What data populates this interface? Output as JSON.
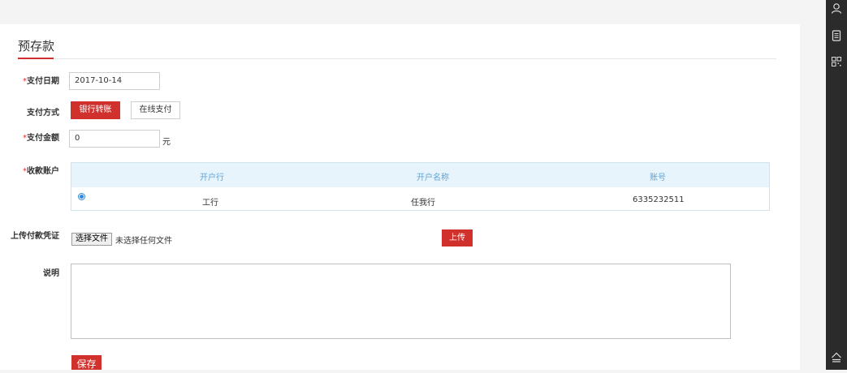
{
  "page": {
    "title": "预存款"
  },
  "form": {
    "date": {
      "label": "支付日期",
      "required": "*",
      "value": "2017-10-14"
    },
    "method": {
      "label": "支付方式",
      "options": [
        "银行转账",
        "在线支付"
      ],
      "selected": "银行转账"
    },
    "amount": {
      "label": "支付金额",
      "required": "*",
      "value": "0",
      "unit": "元"
    },
    "account": {
      "label": "收款账户",
      "required": "*",
      "columns": [
        "开户行",
        "开户名称",
        "账号"
      ],
      "rows": [
        {
          "bank": "工行",
          "name": "任我行",
          "number": "6335232511",
          "selected": true
        }
      ]
    },
    "upload": {
      "label": "上传付款凭证",
      "choose_label": "选择文件",
      "status": "未选择任何文件",
      "upload_label": "上传"
    },
    "note": {
      "label": "说明",
      "value": ""
    },
    "save_label": "保存"
  },
  "sidebar": {
    "icons": [
      "user-icon",
      "document-icon",
      "qrcode-icon",
      "back-to-top-icon"
    ]
  },
  "colors": {
    "accent": "#d0312d",
    "table_header_bg": "#e8f4fb",
    "table_header_text": "#5fa4d6",
    "sidebar_bg": "#2b2b2b"
  }
}
